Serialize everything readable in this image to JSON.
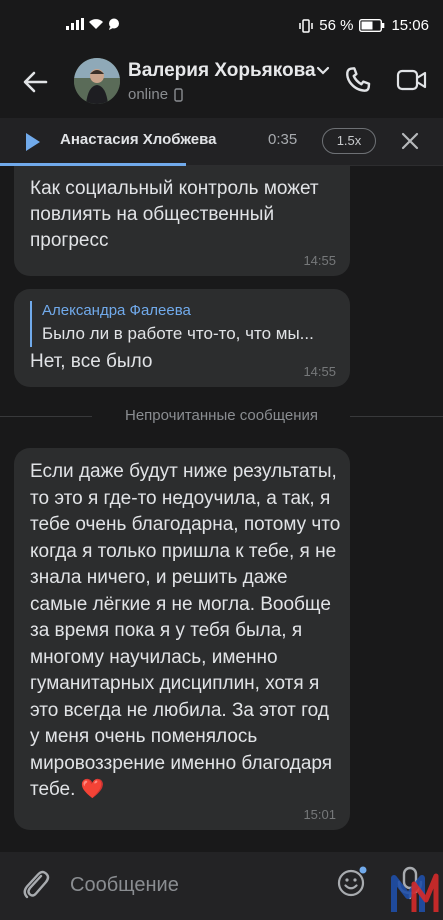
{
  "status_bar": {
    "battery": "56 %",
    "time": "15:06"
  },
  "header": {
    "contact_name": "Валерия Хорьякова",
    "status": "online"
  },
  "player": {
    "track_name": "Анастасия Хлобжева",
    "time": "0:35",
    "speed": "1.5x",
    "progress": 0.42
  },
  "messages": [
    {
      "text": "Как социальный контроль может  повлиять на общественный прогресс",
      "time": "14:55"
    },
    {
      "reply_author": "Александра Фалеева",
      "reply_text": "Было ли в работе что-то, что мы...",
      "text": "Нет, все было",
      "time": "14:55"
    },
    {
      "text": "Если даже будут ниже результаты, то это я где-то недоучила, а так, я тебе очень благодарна, потому что когда я только пришла к тебе, я не знала ничего, и решить даже самые лёгкие я не могла. Вообще за время пока я у тебя была, я многому научилась, именно гуманитарных дисциплин, хотя я это всегда не любила. За этот год у меня очень поменялось мировоззрение именно благодаря тебе. ❤️",
      "time": "15:01"
    }
  ],
  "divider_label": "Непрочитанные сообщения",
  "composer": {
    "placeholder": "Сообщение"
  },
  "colors": {
    "accent": "#71aaeb",
    "bubble": "#2c2d2e",
    "background": "#19191a",
    "heart": "#e64646"
  }
}
